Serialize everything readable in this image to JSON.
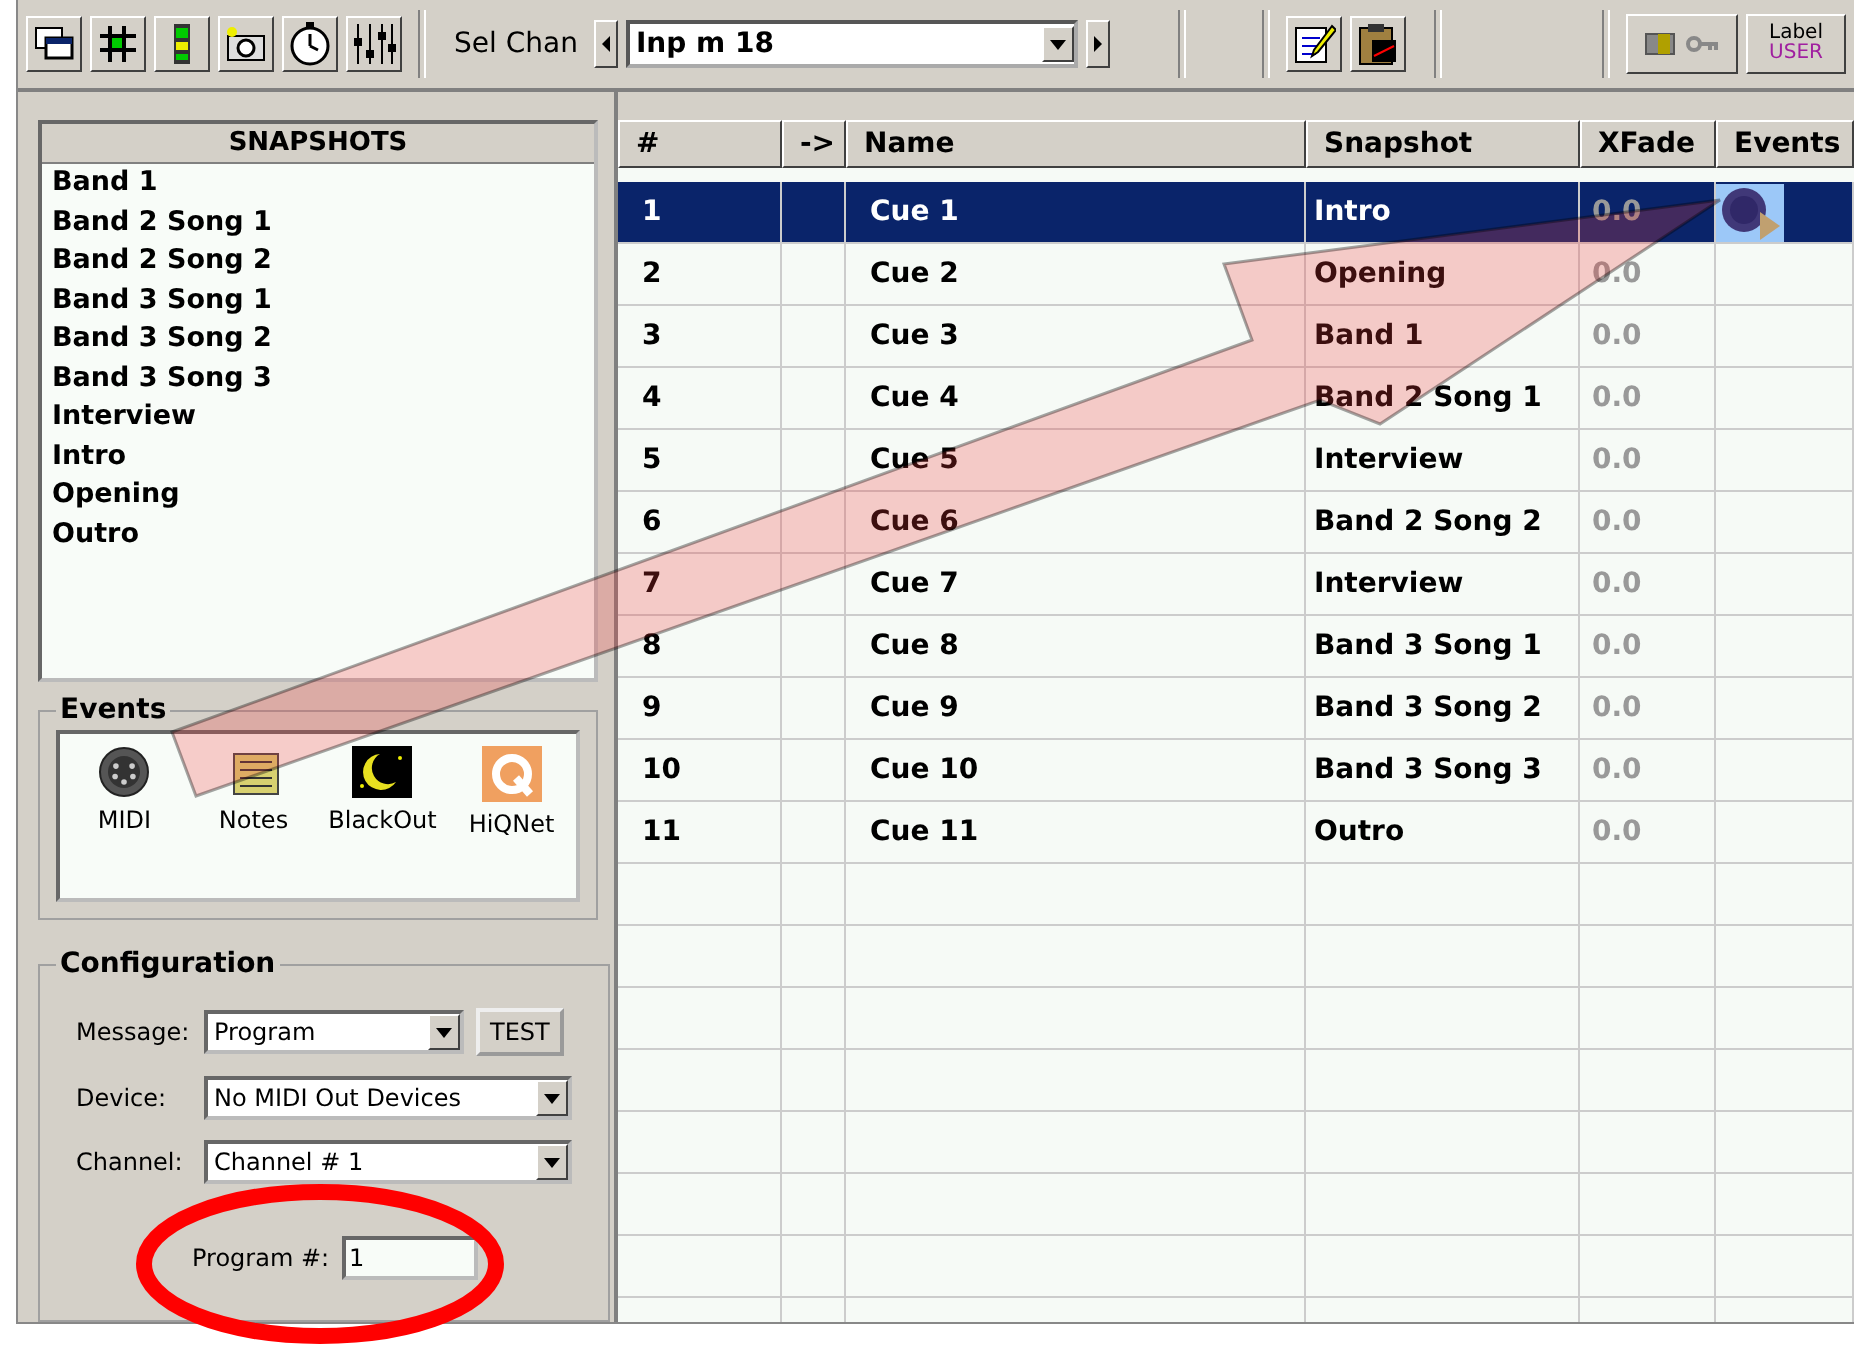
{
  "toolbar": {
    "channel_label": "Sel Chan",
    "channel_value": "Inp m 18",
    "label_button": {
      "line_1": "Label",
      "line_2": "USER"
    }
  },
  "snapshots": {
    "title": "SNAPSHOTS",
    "items": [
      "Band 1",
      "Band 2 Song 1",
      "Band 2 Song 2",
      "Band 3 Song 1",
      "Band 3 Song 2",
      "Band 3 Song 3",
      "Interview",
      "Intro",
      "Opening",
      "Outro"
    ]
  },
  "events": {
    "title": "Events",
    "items": [
      {
        "kind": "midi",
        "label": "MIDI"
      },
      {
        "kind": "notes",
        "label": "Notes"
      },
      {
        "kind": "blackout",
        "label": "BlackOut"
      },
      {
        "kind": "hiqnet",
        "label": "HiQNet"
      }
    ]
  },
  "configuration": {
    "title": "Configuration",
    "message_label": "Message:",
    "message_value": "Program",
    "test_button": "TEST",
    "device_label": "Device:",
    "device_value": "No MIDI Out Devices",
    "channel_label": "Channel:",
    "channel_value": "Channel # 1",
    "program_label": "Program #:",
    "program_value": "1"
  },
  "table": {
    "columns": [
      "#",
      "->",
      "Name",
      "Snapshot",
      "XFade",
      "Events"
    ],
    "rows": [
      {
        "number": "1",
        "name": "Cue 1",
        "snapshot": "Intro",
        "xfade": "0.0",
        "midi_event": true,
        "selected": true
      },
      {
        "number": "2",
        "name": "Cue 2",
        "snapshot": "Opening",
        "xfade": "0.0",
        "midi_event": false,
        "selected": false
      },
      {
        "number": "3",
        "name": "Cue 3",
        "snapshot": "Band 1",
        "xfade": "0.0",
        "midi_event": false,
        "selected": false
      },
      {
        "number": "4",
        "name": "Cue 4",
        "snapshot": "Band 2 Song 1",
        "xfade": "0.0",
        "midi_event": false,
        "selected": false
      },
      {
        "number": "5",
        "name": "Cue 5",
        "snapshot": "Interview",
        "xfade": "0.0",
        "midi_event": false,
        "selected": false
      },
      {
        "number": "6",
        "name": "Cue 6",
        "snapshot": "Band 2 Song 2",
        "xfade": "0.0",
        "midi_event": false,
        "selected": false
      },
      {
        "number": "7",
        "name": "Cue 7",
        "snapshot": "Interview",
        "xfade": "0.0",
        "midi_event": false,
        "selected": false
      },
      {
        "number": "8",
        "name": "Cue 8",
        "snapshot": "Band 3 Song 1",
        "xfade": "0.0",
        "midi_event": false,
        "selected": false
      },
      {
        "number": "9",
        "name": "Cue 9",
        "snapshot": "Band 3 Song 2",
        "xfade": "0.0",
        "midi_event": false,
        "selected": false
      },
      {
        "number": "10",
        "name": "Cue 10",
        "snapshot": "Band 3 Song 3",
        "xfade": "0.0",
        "midi_event": false,
        "selected": false
      },
      {
        "number": "11",
        "name": "Cue 11",
        "snapshot": "Outro",
        "xfade": "0.0",
        "midi_event": false,
        "selected": false
      }
    ]
  }
}
